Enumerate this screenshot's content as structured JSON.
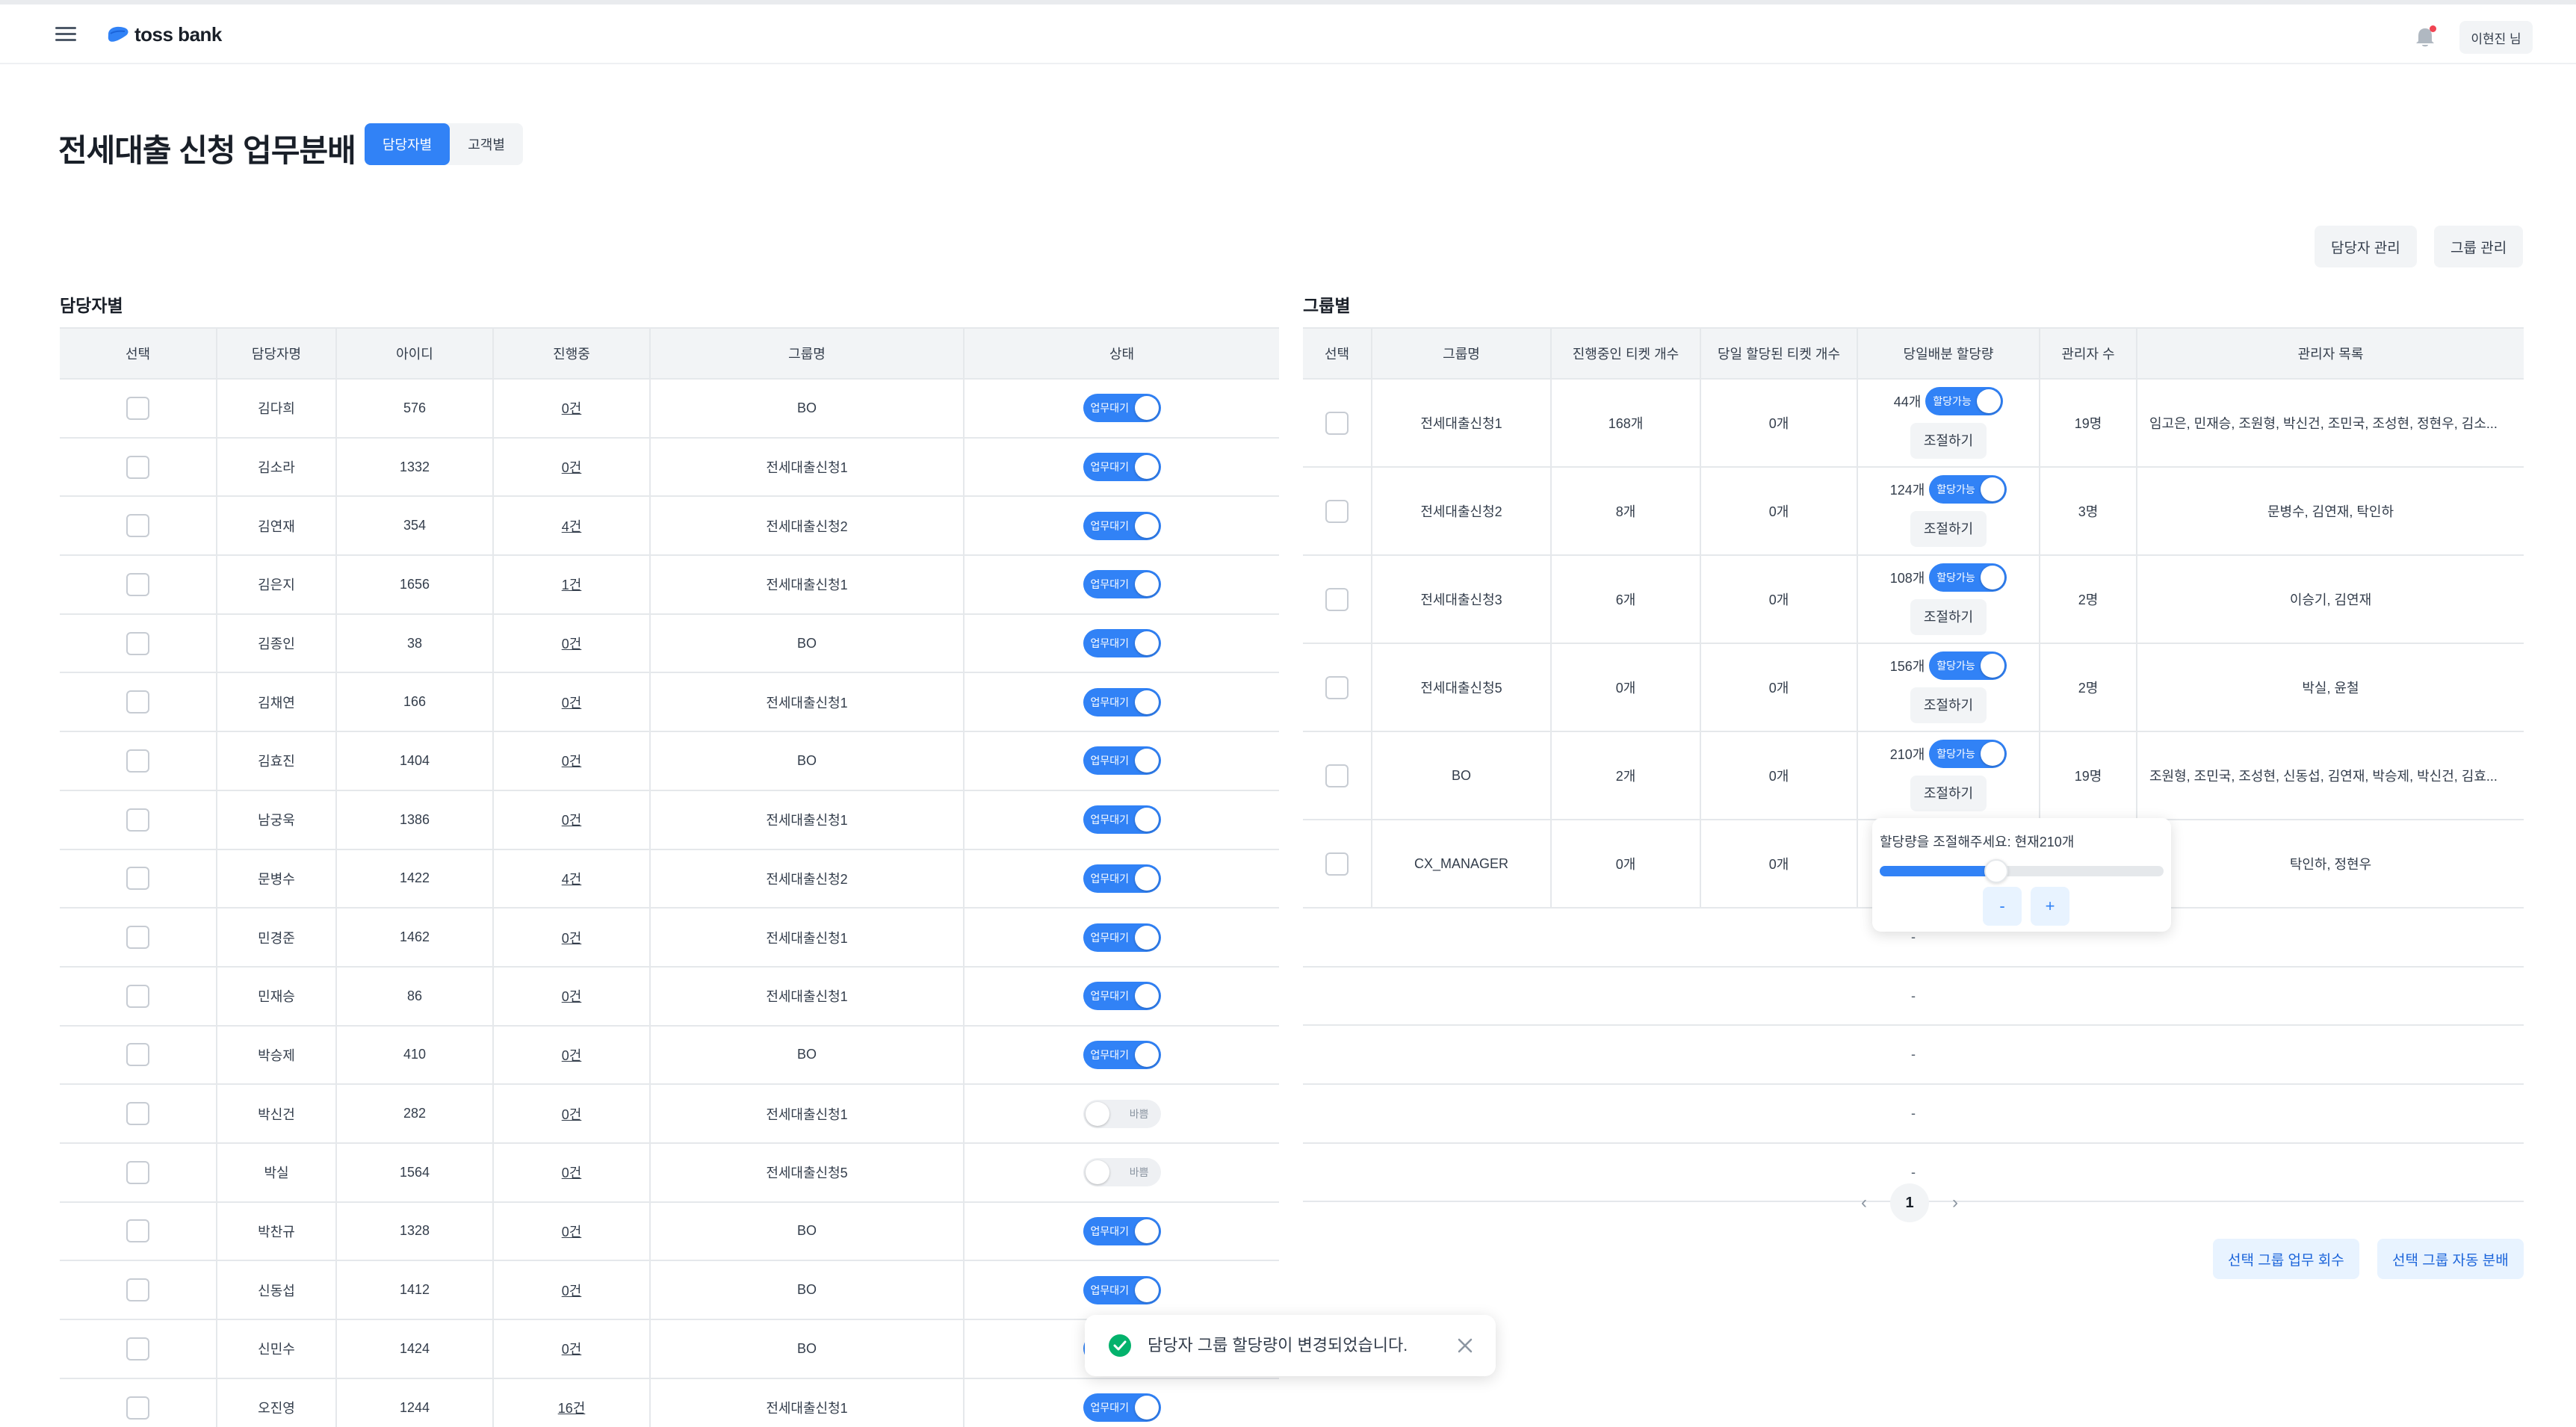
{
  "header": {
    "brand": "toss bank",
    "user_label": "이현진 님"
  },
  "page": {
    "title": "전세대출 신청 업무분배",
    "tabs": [
      {
        "label": "담당자별",
        "active": true
      },
      {
        "label": "고객별",
        "active": false
      }
    ],
    "manage_staff_label": "담당자 관리",
    "manage_group_label": "그룹 관리"
  },
  "staff_section": {
    "title": "담당자별",
    "columns": [
      "선택",
      "담당자명",
      "아이디",
      "진행중",
      "그룹명",
      "상태"
    ],
    "rows": [
      {
        "name": "김다희",
        "id": "576",
        "in_progress": "0건",
        "group": "BO",
        "status": "업무대기",
        "on": true
      },
      {
        "name": "김소라",
        "id": "1332",
        "in_progress": "0건",
        "group": "전세대출신청1",
        "status": "업무대기",
        "on": true
      },
      {
        "name": "김연재",
        "id": "354",
        "in_progress": "4건",
        "group": "전세대출신청2",
        "status": "업무대기",
        "on": true
      },
      {
        "name": "김은지",
        "id": "1656",
        "in_progress": "1건",
        "group": "전세대출신청1",
        "status": "업무대기",
        "on": true
      },
      {
        "name": "김종인",
        "id": "38",
        "in_progress": "0건",
        "group": "BO",
        "status": "업무대기",
        "on": true
      },
      {
        "name": "김채연",
        "id": "166",
        "in_progress": "0건",
        "group": "전세대출신청1",
        "status": "업무대기",
        "on": true
      },
      {
        "name": "김효진",
        "id": "1404",
        "in_progress": "0건",
        "group": "BO",
        "status": "업무대기",
        "on": true
      },
      {
        "name": "남궁욱",
        "id": "1386",
        "in_progress": "0건",
        "group": "전세대출신청1",
        "status": "업무대기",
        "on": true
      },
      {
        "name": "문병수",
        "id": "1422",
        "in_progress": "4건",
        "group": "전세대출신청2",
        "status": "업무대기",
        "on": true
      },
      {
        "name": "민경준",
        "id": "1462",
        "in_progress": "0건",
        "group": "전세대출신청1",
        "status": "업무대기",
        "on": true
      },
      {
        "name": "민재승",
        "id": "86",
        "in_progress": "0건",
        "group": "전세대출신청1",
        "status": "업무대기",
        "on": true
      },
      {
        "name": "박승제",
        "id": "410",
        "in_progress": "0건",
        "group": "BO",
        "status": "업무대기",
        "on": true
      },
      {
        "name": "박신건",
        "id": "282",
        "in_progress": "0건",
        "group": "전세대출신청1",
        "status": "바쁨",
        "on": false
      },
      {
        "name": "박실",
        "id": "1564",
        "in_progress": "0건",
        "group": "전세대출신청5",
        "status": "바쁨",
        "on": false
      },
      {
        "name": "박찬규",
        "id": "1328",
        "in_progress": "0건",
        "group": "BO",
        "status": "업무대기",
        "on": true
      },
      {
        "name": "신동섭",
        "id": "1412",
        "in_progress": "0건",
        "group": "BO",
        "status": "업무대기",
        "on": true
      },
      {
        "name": "신민수",
        "id": "1424",
        "in_progress": "0건",
        "group": "BO",
        "status": "업무대기",
        "on": true
      },
      {
        "name": "오진영",
        "id": "1244",
        "in_progress": "16건",
        "group": "전세대출신청1",
        "status": "업무대기",
        "on": true
      }
    ]
  },
  "group_section": {
    "title": "그룹별",
    "columns": [
      "선택",
      "그룹명",
      "진행중인 티켓 개수",
      "당일 할당된 티켓 개수",
      "당일배분 할당량",
      "관리자 수",
      "관리자 목록"
    ],
    "adjust_label": "조절하기",
    "alloc_toggle_label": "할당가능",
    "rows": [
      {
        "name": "전세대출신청1",
        "active_tickets": "168개",
        "today_tickets": "0개",
        "quota": "44개",
        "admin_count": "19명",
        "admins": "임고은, 민재승, 조원형, 박신건, 조민국, 조성현, 정현우, 김소..."
      },
      {
        "name": "전세대출신청2",
        "active_tickets": "8개",
        "today_tickets": "0개",
        "quota": "124개",
        "admin_count": "3명",
        "admins": "문병수, 김연재, 탁인하"
      },
      {
        "name": "전세대출신청3",
        "active_tickets": "6개",
        "today_tickets": "0개",
        "quota": "108개",
        "admin_count": "2명",
        "admins": "이승기, 김연재"
      },
      {
        "name": "전세대출신청5",
        "active_tickets": "0개",
        "today_tickets": "0개",
        "quota": "156개",
        "admin_count": "2명",
        "admins": "박실, 윤철"
      },
      {
        "name": "BO",
        "active_tickets": "2개",
        "today_tickets": "0개",
        "quota": "210개",
        "admin_count": "19명",
        "admins": "조원형, 조민국, 조성현, 신동섭, 김연재, 박승제, 박신건, 김효..."
      },
      {
        "name": "CX_MANAGER",
        "active_tickets": "0개",
        "today_tickets": "0개",
        "quota": "",
        "admin_count": "",
        "admins": "탁인하, 정현우"
      }
    ],
    "empty_rows": [
      "-",
      "-",
      "-",
      "-",
      "-"
    ],
    "pagination": {
      "current": "1"
    },
    "btn_recall": "선택 그룹 업무 회수",
    "btn_auto": "선택 그룹 자동 분배"
  },
  "popover": {
    "text": "할당량을 조절해주세요: 현재210개",
    "minus": "-",
    "plus": "+",
    "slider_fraction": 0.41
  },
  "toast": {
    "message": "담당자 그룹 할당량이 변경되었습니다."
  },
  "colors": {
    "accent": "#3182f6",
    "success": "#03b26c",
    "alert": "#f04452"
  }
}
